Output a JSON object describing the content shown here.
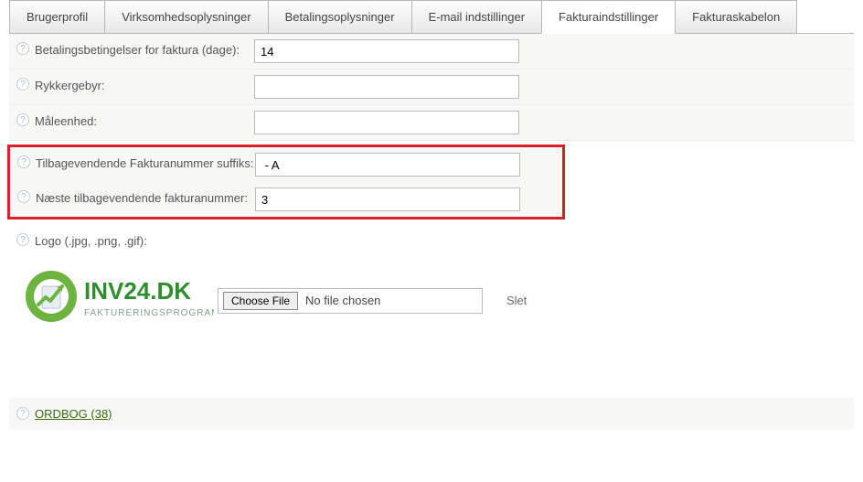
{
  "tabs": [
    {
      "label": "Brugerprofil",
      "active": false
    },
    {
      "label": "Virksomhedsoplysninger",
      "active": false
    },
    {
      "label": "Betalingsoplysninger",
      "active": false
    },
    {
      "label": "E-mail indstillinger",
      "active": false
    },
    {
      "label": "Fakturaindstillinger",
      "active": true
    },
    {
      "label": "Fakturaskabelon",
      "active": false
    }
  ],
  "fields": {
    "payment_terms": {
      "label": "Betalingsbetingelser for faktura (dage):",
      "value": "14"
    },
    "reminder_fee": {
      "label": "Rykkergebyr:",
      "value": ""
    },
    "unit": {
      "label": "Måleenhed:",
      "value": ""
    },
    "recurring_suffix": {
      "label": "Tilbagevendende Fakturanummer suffiks:",
      "value": " - A"
    },
    "recurring_next": {
      "label": "Næste tilbagevendende fakturanummer:",
      "value": "3"
    },
    "logo": {
      "label": "Logo (.jpg, .png, .gif):"
    }
  },
  "file": {
    "button": "Choose File",
    "status": "No file chosen",
    "delete": "Slet"
  },
  "logo": {
    "brand": "INV24.DK",
    "tagline": "FAKTURERINGSPROGRAM"
  },
  "dictionary": {
    "label": "ORDBOG (38)"
  },
  "help_glyph": "?"
}
